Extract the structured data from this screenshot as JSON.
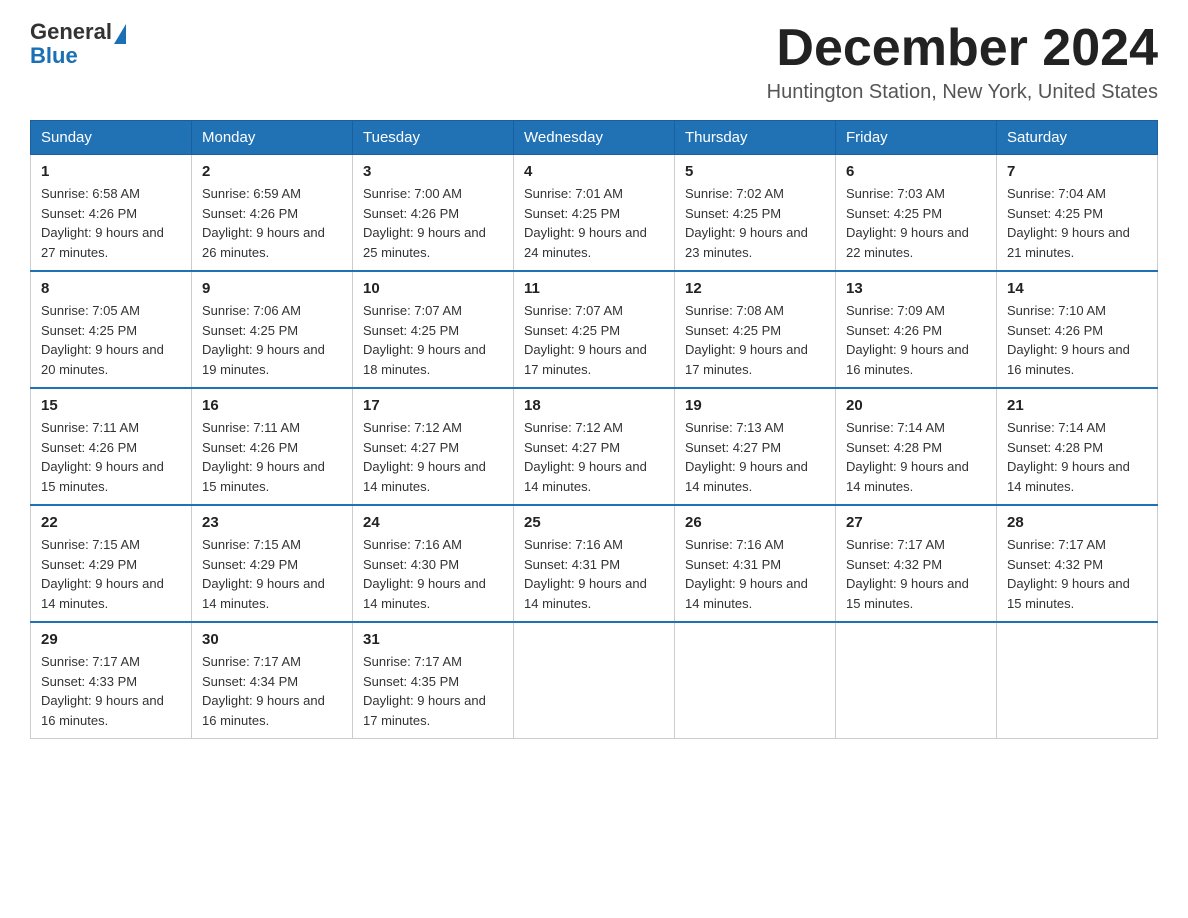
{
  "logo": {
    "general": "General",
    "blue": "Blue"
  },
  "title": {
    "month_year": "December 2024",
    "location": "Huntington Station, New York, United States"
  },
  "days_of_week": [
    "Sunday",
    "Monday",
    "Tuesday",
    "Wednesday",
    "Thursday",
    "Friday",
    "Saturday"
  ],
  "weeks": [
    [
      {
        "day": "1",
        "sunrise": "6:58 AM",
        "sunset": "4:26 PM",
        "daylight": "9 hours and 27 minutes."
      },
      {
        "day": "2",
        "sunrise": "6:59 AM",
        "sunset": "4:26 PM",
        "daylight": "9 hours and 26 minutes."
      },
      {
        "day": "3",
        "sunrise": "7:00 AM",
        "sunset": "4:26 PM",
        "daylight": "9 hours and 25 minutes."
      },
      {
        "day": "4",
        "sunrise": "7:01 AM",
        "sunset": "4:25 PM",
        "daylight": "9 hours and 24 minutes."
      },
      {
        "day": "5",
        "sunrise": "7:02 AM",
        "sunset": "4:25 PM",
        "daylight": "9 hours and 23 minutes."
      },
      {
        "day": "6",
        "sunrise": "7:03 AM",
        "sunset": "4:25 PM",
        "daylight": "9 hours and 22 minutes."
      },
      {
        "day": "7",
        "sunrise": "7:04 AM",
        "sunset": "4:25 PM",
        "daylight": "9 hours and 21 minutes."
      }
    ],
    [
      {
        "day": "8",
        "sunrise": "7:05 AM",
        "sunset": "4:25 PM",
        "daylight": "9 hours and 20 minutes."
      },
      {
        "day": "9",
        "sunrise": "7:06 AM",
        "sunset": "4:25 PM",
        "daylight": "9 hours and 19 minutes."
      },
      {
        "day": "10",
        "sunrise": "7:07 AM",
        "sunset": "4:25 PM",
        "daylight": "9 hours and 18 minutes."
      },
      {
        "day": "11",
        "sunrise": "7:07 AM",
        "sunset": "4:25 PM",
        "daylight": "9 hours and 17 minutes."
      },
      {
        "day": "12",
        "sunrise": "7:08 AM",
        "sunset": "4:25 PM",
        "daylight": "9 hours and 17 minutes."
      },
      {
        "day": "13",
        "sunrise": "7:09 AM",
        "sunset": "4:26 PM",
        "daylight": "9 hours and 16 minutes."
      },
      {
        "day": "14",
        "sunrise": "7:10 AM",
        "sunset": "4:26 PM",
        "daylight": "9 hours and 16 minutes."
      }
    ],
    [
      {
        "day": "15",
        "sunrise": "7:11 AM",
        "sunset": "4:26 PM",
        "daylight": "9 hours and 15 minutes."
      },
      {
        "day": "16",
        "sunrise": "7:11 AM",
        "sunset": "4:26 PM",
        "daylight": "9 hours and 15 minutes."
      },
      {
        "day": "17",
        "sunrise": "7:12 AM",
        "sunset": "4:27 PM",
        "daylight": "9 hours and 14 minutes."
      },
      {
        "day": "18",
        "sunrise": "7:12 AM",
        "sunset": "4:27 PM",
        "daylight": "9 hours and 14 minutes."
      },
      {
        "day": "19",
        "sunrise": "7:13 AM",
        "sunset": "4:27 PM",
        "daylight": "9 hours and 14 minutes."
      },
      {
        "day": "20",
        "sunrise": "7:14 AM",
        "sunset": "4:28 PM",
        "daylight": "9 hours and 14 minutes."
      },
      {
        "day": "21",
        "sunrise": "7:14 AM",
        "sunset": "4:28 PM",
        "daylight": "9 hours and 14 minutes."
      }
    ],
    [
      {
        "day": "22",
        "sunrise": "7:15 AM",
        "sunset": "4:29 PM",
        "daylight": "9 hours and 14 minutes."
      },
      {
        "day": "23",
        "sunrise": "7:15 AM",
        "sunset": "4:29 PM",
        "daylight": "9 hours and 14 minutes."
      },
      {
        "day": "24",
        "sunrise": "7:16 AM",
        "sunset": "4:30 PM",
        "daylight": "9 hours and 14 minutes."
      },
      {
        "day": "25",
        "sunrise": "7:16 AM",
        "sunset": "4:31 PM",
        "daylight": "9 hours and 14 minutes."
      },
      {
        "day": "26",
        "sunrise": "7:16 AM",
        "sunset": "4:31 PM",
        "daylight": "9 hours and 14 minutes."
      },
      {
        "day": "27",
        "sunrise": "7:17 AM",
        "sunset": "4:32 PM",
        "daylight": "9 hours and 15 minutes."
      },
      {
        "day": "28",
        "sunrise": "7:17 AM",
        "sunset": "4:32 PM",
        "daylight": "9 hours and 15 minutes."
      }
    ],
    [
      {
        "day": "29",
        "sunrise": "7:17 AM",
        "sunset": "4:33 PM",
        "daylight": "9 hours and 16 minutes."
      },
      {
        "day": "30",
        "sunrise": "7:17 AM",
        "sunset": "4:34 PM",
        "daylight": "9 hours and 16 minutes."
      },
      {
        "day": "31",
        "sunrise": "7:17 AM",
        "sunset": "4:35 PM",
        "daylight": "9 hours and 17 minutes."
      },
      null,
      null,
      null,
      null
    ]
  ],
  "labels": {
    "sunrise": "Sunrise:",
    "sunset": "Sunset:",
    "daylight": "Daylight:"
  }
}
